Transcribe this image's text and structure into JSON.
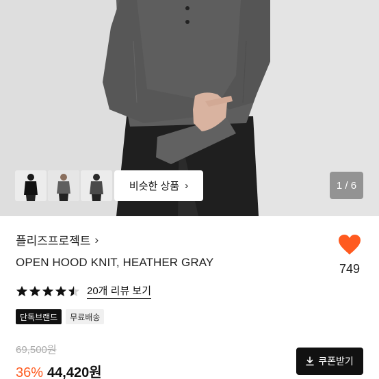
{
  "gallery": {
    "similar_label": "비슷한 상품",
    "similar_chevron": "›",
    "page_indicator": "1 / 6",
    "thumbnail_count": 3
  },
  "product": {
    "brand": "플리즈프로젝트",
    "brand_chevron": "›",
    "title": "OPEN HOOD KNIT, HEATHER GRAY",
    "like_count": "749",
    "rating": 4.5,
    "review_link": "20개 리뷰 보기",
    "badges": [
      "단독브랜드",
      "무료배송"
    ],
    "original_price": "69,500원",
    "discount": "36%",
    "final_price": "44,420원",
    "coupon_label": "쿠폰받기"
  },
  "colors": {
    "accent": "#ff5a1f",
    "heart": "#ff5a1f",
    "dark": "#111111"
  },
  "icons": {
    "heart": "heart-icon",
    "star": "star-icon",
    "download": "download-icon"
  }
}
